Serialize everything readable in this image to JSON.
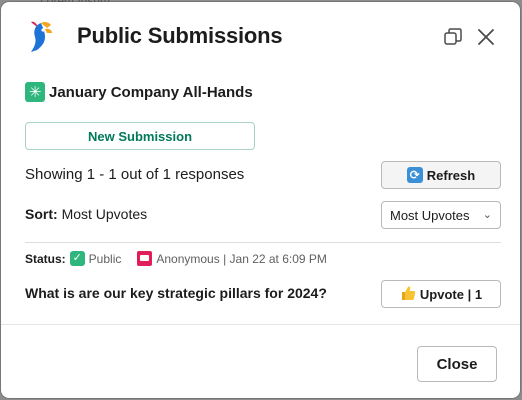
{
  "background_text": "Lorem Ipsum",
  "modal": {
    "title": "Public Submissions",
    "channel": "January Company All-Hands",
    "new_submission_label": "New Submission",
    "showing_text": "Showing 1 - 1 out of 1 responses",
    "refresh_label": "Refresh",
    "sort_label": "Sort:",
    "sort_value": "Most Upvotes",
    "sort_select_value": "Most Upvotes",
    "submission": {
      "status_label": "Status:",
      "status_value": "Public",
      "author": "Anonymous | Jan 22 at 6:09 PM",
      "question": "What is are our key strategic pillars for 2024?",
      "upvote_label": "Upvote | 1"
    },
    "close_label": "Close"
  },
  "icons": {
    "logo": "parrot-logo-icon",
    "expand": "expand-window-icon",
    "close": "close-icon",
    "channel": "sparkle-icon",
    "refresh": "refresh-icon",
    "status": "check-icon",
    "anonymous": "anonymous-icon",
    "upvote": "thumbs-up-icon",
    "dropdown": "chevron-down-icon"
  },
  "colors": {
    "accent_green": "#007a5a",
    "status_green": "#2eb67d",
    "anon_red": "#e01e5a"
  }
}
